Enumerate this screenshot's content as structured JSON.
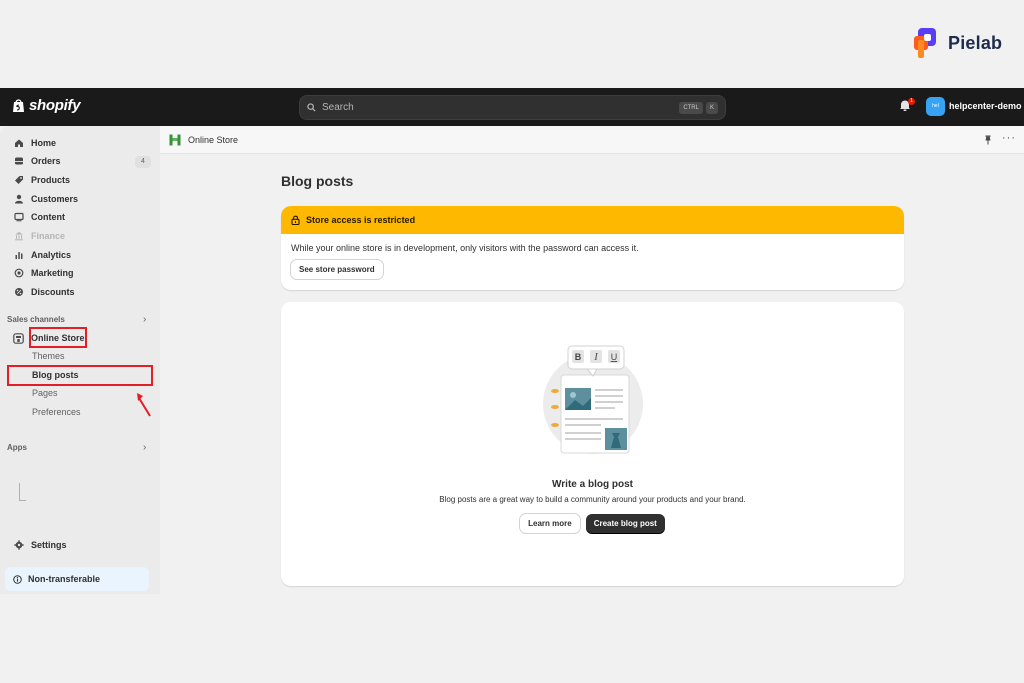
{
  "watermark": {
    "brand": "Pielab"
  },
  "topbar": {
    "logo_text": "shopify",
    "search_placeholder": "Search",
    "shortcut_keys": [
      "CTRL",
      "K"
    ],
    "notification_count": "1",
    "store_avatar": "hel",
    "store_name": "helpcenter-demo"
  },
  "sidebar": {
    "items": [
      {
        "label": "Home",
        "icon": "home-icon"
      },
      {
        "label": "Orders",
        "icon": "orders-icon",
        "count": "4"
      },
      {
        "label": "Products",
        "icon": "tag-icon"
      },
      {
        "label": "Customers",
        "icon": "person-icon"
      },
      {
        "label": "Content",
        "icon": "content-icon"
      },
      {
        "label": "Finance",
        "icon": "bank-icon",
        "disabled": true
      },
      {
        "label": "Analytics",
        "icon": "bar-chart-icon"
      },
      {
        "label": "Marketing",
        "icon": "target-icon"
      },
      {
        "label": "Discounts",
        "icon": "discount-icon"
      }
    ],
    "sales_channels_label": "Sales channels",
    "online_store": {
      "label": "Online Store",
      "icon": "store-icon"
    },
    "sub_items": [
      "Themes",
      "Blog posts",
      "Pages",
      "Preferences"
    ],
    "apps_label": "Apps",
    "settings_label": "Settings",
    "non_transferable_label": "Non-transferable"
  },
  "main": {
    "breadcrumb": "Online Store",
    "page_title": "Blog posts",
    "banner": {
      "title": "Store access is restricted",
      "message": "While your online store is in development, only visitors with the password can access it.",
      "button_label": "See store password"
    },
    "empty_state": {
      "title": "Write a blog post",
      "description": "Blog posts are a great way to build a community around your products and your brand.",
      "secondary_button": "Learn more",
      "primary_button": "Create blog post",
      "toolbar_glyphs": [
        "B",
        "I",
        "U"
      ]
    }
  },
  "colors": {
    "banner_yellow": "#ffb800",
    "highlight_red": "#e41e26",
    "topbar_bg": "#1a1a1a",
    "avatar_blue": "#36a3f5"
  }
}
